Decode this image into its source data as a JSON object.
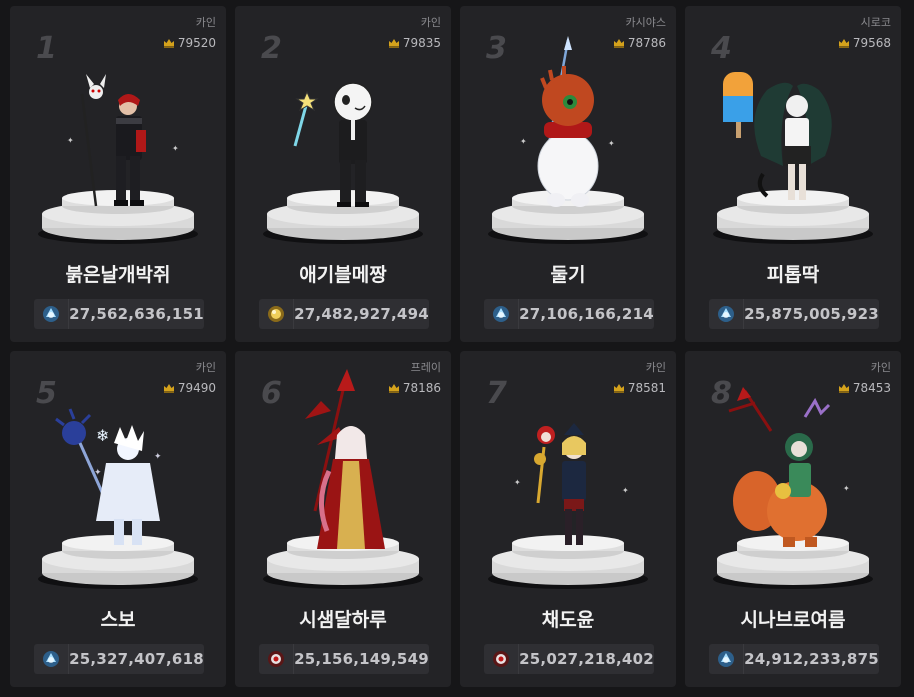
{
  "ranking": {
    "cards": [
      {
        "rank": "1",
        "server": "카인",
        "fame": "79520",
        "name": "붉은날개박쥐",
        "power": "27,562,636,151",
        "power_icon": "buff-crystal-icon",
        "character": "bat-knight-character"
      },
      {
        "rank": "2",
        "server": "카인",
        "fame": "79835",
        "name": "애기블메짱",
        "power": "27,482,927,494",
        "power_icon": "gold-orb-icon",
        "character": "masked-suit-character"
      },
      {
        "rank": "3",
        "server": "카시야스",
        "fame": "78786",
        "name": "둘기",
        "power": "27,106,166,214",
        "power_icon": "buff-crystal-icon",
        "character": "snowman-character"
      },
      {
        "rank": "4",
        "server": "시로코",
        "fame": "79568",
        "name": "피톱딱",
        "power": "25,875,005,923",
        "power_icon": "buff-crystal-icon",
        "character": "popsicle-character"
      },
      {
        "rank": "5",
        "server": "카인",
        "fame": "79490",
        "name": "스보",
        "power": "25,327,407,618",
        "power_icon": "buff-crystal-icon",
        "character": "white-mage-character"
      },
      {
        "rank": "6",
        "server": "프레이",
        "fame": "78186",
        "name": "시샘달하루",
        "power": "25,156,149,549",
        "power_icon": "red-eye-icon",
        "character": "red-lance-character"
      },
      {
        "rank": "7",
        "server": "카인",
        "fame": "78581",
        "name": "채도윤",
        "power": "25,027,218,402",
        "power_icon": "red-eye-icon",
        "character": "staff-girl-character"
      },
      {
        "rank": "8",
        "server": "카인",
        "fame": "78453",
        "name": "시나브로여름",
        "power": "24,912,233,875",
        "power_icon": "buff-crystal-icon",
        "character": "squirrel-rider-character"
      }
    ]
  },
  "colors": {
    "background": "#161618",
    "card": "#232326",
    "rank_number": "#4a4a4e",
    "fame_icon": "#d4a21c"
  }
}
